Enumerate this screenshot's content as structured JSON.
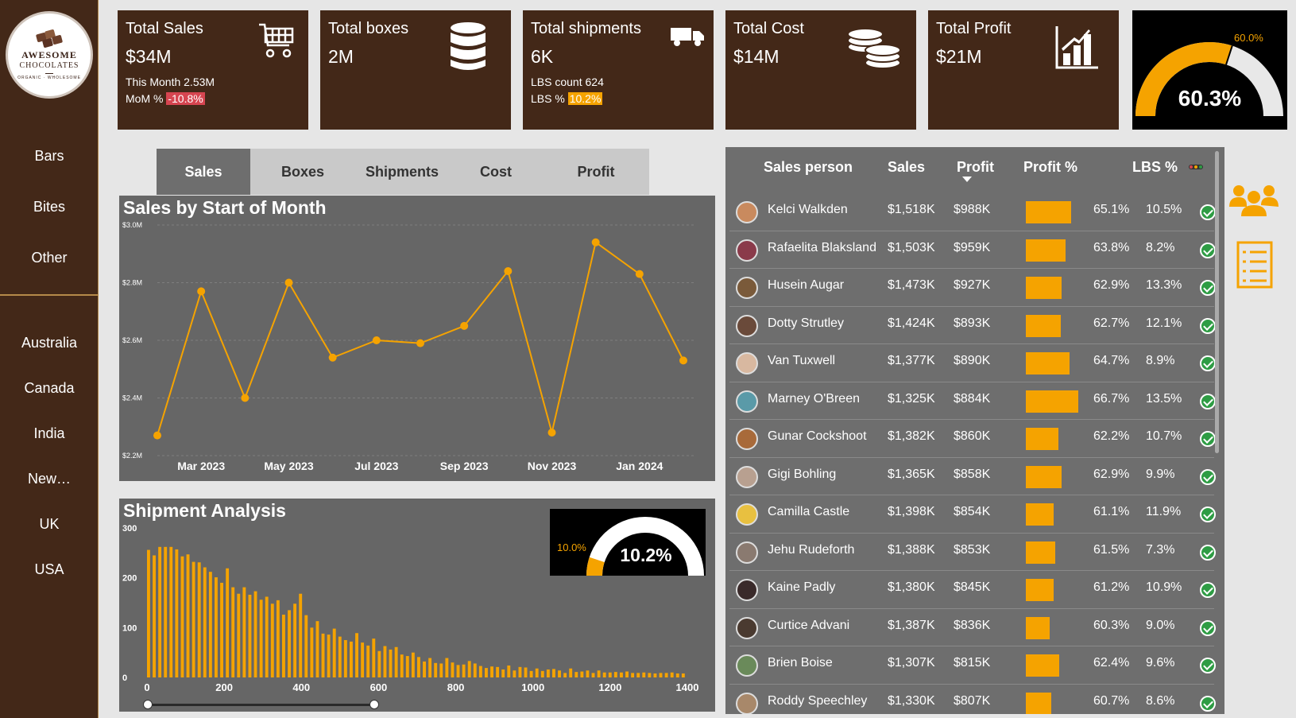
{
  "logo": {
    "line1": "AWESOME",
    "line2": "CHOCOLATES",
    "line3": "ORGANIC · WHOLESOME"
  },
  "sidebar": {
    "products": [
      "Bars",
      "Bites",
      "Other"
    ],
    "countries": [
      "Australia",
      "Canada",
      "India",
      "New…",
      "UK",
      "USA"
    ]
  },
  "kpis": [
    {
      "label": "Total Sales",
      "value": "$34M",
      "sub1_prefix": "This Month ",
      "sub1_value": "2.53M",
      "sub2_prefix": "MoM % ",
      "sub2_badge": "-10.8%",
      "icon": "cart-icon"
    },
    {
      "label": "Total boxes",
      "value": "2M",
      "icon": "database-icon"
    },
    {
      "label": "Total shipments",
      "value": "6K",
      "sub1_prefix": "LBS count ",
      "sub1_value": "624",
      "sub2_prefix": "LBS % ",
      "sub2_badge": "10.2%",
      "icon": "truck-icon"
    },
    {
      "label": "Total Cost",
      "value": "$14M",
      "icon": "coins-icon"
    },
    {
      "label": "Total Profit",
      "value": "$21M",
      "icon": "bar-chart-icon"
    }
  ],
  "profit_gauge": {
    "value_label": "60.3%",
    "target_label": "60.0%",
    "value": 0.603,
    "target": 0.6
  },
  "tabs": [
    "Sales",
    "Boxes",
    "Shipments",
    "Cost",
    "Profit"
  ],
  "active_tab": "Sales",
  "colors": {
    "brown": "#432818",
    "accent": "#f5a300",
    "panel": "#666666"
  },
  "chart_data": [
    {
      "type": "line",
      "title": "Sales by Start of Month",
      "x": [
        "Feb 2023",
        "Mar 2023",
        "Apr 2023",
        "May 2023",
        "Jun 2023",
        "Jul 2023",
        "Aug 2023",
        "Sep 2023",
        "Oct 2023",
        "Nov 2023",
        "Dec 2023",
        "Jan 2024",
        "Feb 2024"
      ],
      "values": [
        2.27,
        2.77,
        2.4,
        2.8,
        2.54,
        2.6,
        2.59,
        2.65,
        2.84,
        2.28,
        2.94,
        2.83,
        2.53
      ],
      "x_tick_labels": [
        "Mar 2023",
        "May 2023",
        "Jul 2023",
        "Sep 2023",
        "Nov 2023",
        "Jan 2024"
      ],
      "y_tick_labels": [
        "$3.0M",
        "$2.8M",
        "$2.6M",
        "$2.4M",
        "$2.2M"
      ],
      "ylim": [
        2.2,
        3.0
      ],
      "grid": true
    },
    {
      "type": "bar",
      "title": "Shipment Analysis",
      "x_tick_labels": [
        "0",
        "200",
        "400",
        "600",
        "800",
        "1000",
        "1200",
        "1400"
      ],
      "y_tick_labels": [
        "300",
        "200",
        "100",
        "0"
      ],
      "xlim": [
        0,
        1400
      ],
      "ylim": [
        0,
        300
      ],
      "values": [
        256,
        245,
        262,
        262,
        262,
        257,
        243,
        247,
        232,
        231,
        221,
        212,
        201,
        190,
        219,
        181,
        168,
        181,
        166,
        173,
        156,
        162,
        148,
        155,
        126,
        135,
        148,
        168,
        125,
        100,
        113,
        88,
        86,
        98,
        82,
        75,
        72,
        89,
        70,
        64,
        78,
        53,
        63,
        56,
        61,
        46,
        43,
        50,
        41,
        32,
        39,
        29,
        28,
        39,
        30,
        25,
        26,
        33,
        28,
        23,
        19,
        22,
        21,
        16,
        24,
        14,
        21,
        20,
        13,
        18,
        13,
        16,
        17,
        14,
        9,
        18,
        11,
        12,
        14,
        9,
        14,
        10,
        10,
        11,
        10,
        12,
        9,
        9,
        10,
        9,
        8,
        9,
        9,
        10,
        8,
        8
      ]
    }
  ],
  "lbs_gauge": {
    "target_label": "10.0%",
    "value_label": "10.2%",
    "value": 0.102
  },
  "table": {
    "columns": [
      "Sales person",
      "Sales",
      "Profit",
      "Profit %",
      "LBS %"
    ],
    "rows": [
      {
        "name": "Kelci Walkden",
        "sales": "$1,518K",
        "profit": "$988K",
        "profit_pct": "65.1%",
        "lbs": "10.5%",
        "p": 0.651,
        "color": "#c98a5e"
      },
      {
        "name": "Rafaelita Blaksland",
        "sales": "$1,503K",
        "profit": "$959K",
        "profit_pct": "63.8%",
        "lbs": "8.2%",
        "p": 0.638,
        "color": "#8a3a4a"
      },
      {
        "name": "Husein Augar",
        "sales": "$1,473K",
        "profit": "$927K",
        "profit_pct": "62.9%",
        "lbs": "13.3%",
        "p": 0.629,
        "color": "#7a5a3a"
      },
      {
        "name": "Dotty Strutley",
        "sales": "$1,424K",
        "profit": "$893K",
        "profit_pct": "62.7%",
        "lbs": "12.1%",
        "p": 0.627,
        "color": "#6a4a3a"
      },
      {
        "name": "Van Tuxwell",
        "sales": "$1,377K",
        "profit": "$890K",
        "profit_pct": "64.7%",
        "lbs": "8.9%",
        "p": 0.647,
        "color": "#d8b8a0"
      },
      {
        "name": "Marney O'Breen",
        "sales": "$1,325K",
        "profit": "$884K",
        "profit_pct": "66.7%",
        "lbs": "13.5%",
        "p": 0.667,
        "color": "#5a9aa8"
      },
      {
        "name": "Gunar Cockshoot",
        "sales": "$1,382K",
        "profit": "$860K",
        "profit_pct": "62.2%",
        "lbs": "10.7%",
        "p": 0.622,
        "color": "#a86a3a"
      },
      {
        "name": "Gigi Bohling",
        "sales": "$1,365K",
        "profit": "$858K",
        "profit_pct": "62.9%",
        "lbs": "9.9%",
        "p": 0.629,
        "color": "#b8a090"
      },
      {
        "name": "Camilla Castle",
        "sales": "$1,398K",
        "profit": "$854K",
        "profit_pct": "61.1%",
        "lbs": "11.9%",
        "p": 0.611,
        "color": "#e8c040"
      },
      {
        "name": "Jehu Rudeforth",
        "sales": "$1,388K",
        "profit": "$853K",
        "profit_pct": "61.5%",
        "lbs": "7.3%",
        "p": 0.615,
        "color": "#8a7a70"
      },
      {
        "name": "Kaine Padly",
        "sales": "$1,380K",
        "profit": "$845K",
        "profit_pct": "61.2%",
        "lbs": "10.9%",
        "p": 0.612,
        "color": "#3a2a2a"
      },
      {
        "name": "Curtice Advani",
        "sales": "$1,387K",
        "profit": "$836K",
        "profit_pct": "60.3%",
        "lbs": "9.0%",
        "p": 0.603,
        "color": "#4a3a30"
      },
      {
        "name": "Brien Boise",
        "sales": "$1,307K",
        "profit": "$815K",
        "profit_pct": "62.4%",
        "lbs": "9.6%",
        "p": 0.624,
        "color": "#6a8a5a"
      },
      {
        "name": "Roddy Speechley",
        "sales": "$1,330K",
        "profit": "$807K",
        "profit_pct": "60.7%",
        "lbs": "8.6%",
        "p": 0.607,
        "color": "#a8886a"
      }
    ]
  }
}
